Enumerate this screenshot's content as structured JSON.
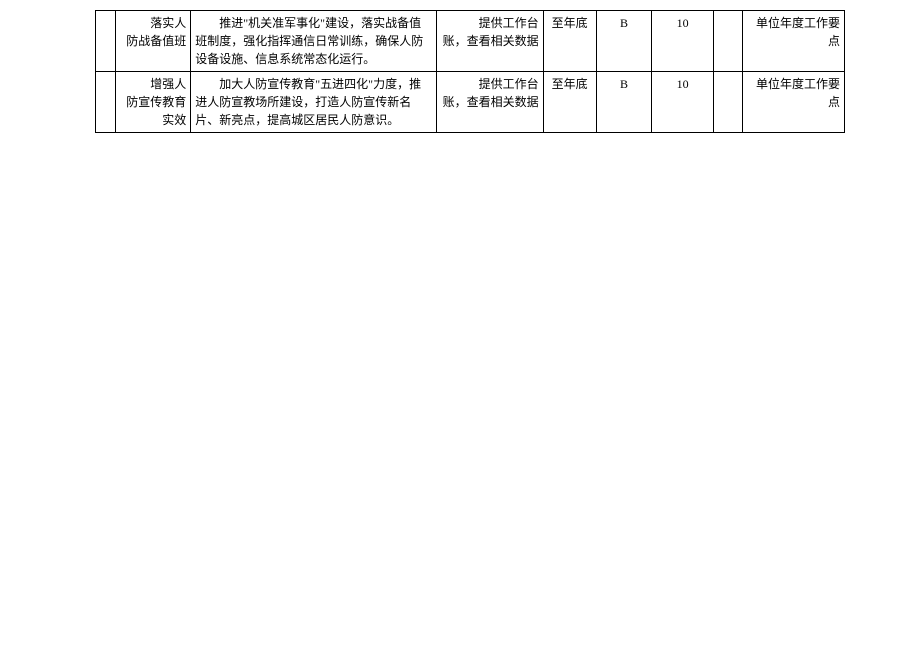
{
  "table": {
    "rows": [
      {
        "col0": "",
        "col1": "落实人防战备值班",
        "col2": "推进\"机关准军事化\"建设，落实战备值班制度，强化指挥通信日常训练，确保人防设备设施、信息系统常态化运行。",
        "col3": "提供工作台账，查看相关数据",
        "col4": "至年底",
        "col5": "B",
        "col6": "10",
        "col7": "",
        "col8": "单位年度工作要点"
      },
      {
        "col0": "",
        "col1": "增强人防宣传教育实效",
        "col2": "加大人防宣传教育\"五进四化\"力度，推进人防宣教场所建设，打造人防宣传新名片、新亮点，提高城区居民人防意识。",
        "col3": "提供工作台账，查看相关数据",
        "col4": "至年底",
        "col5": "B",
        "col6": "10",
        "col7": "",
        "col8": "单位年度工作要点"
      }
    ]
  }
}
